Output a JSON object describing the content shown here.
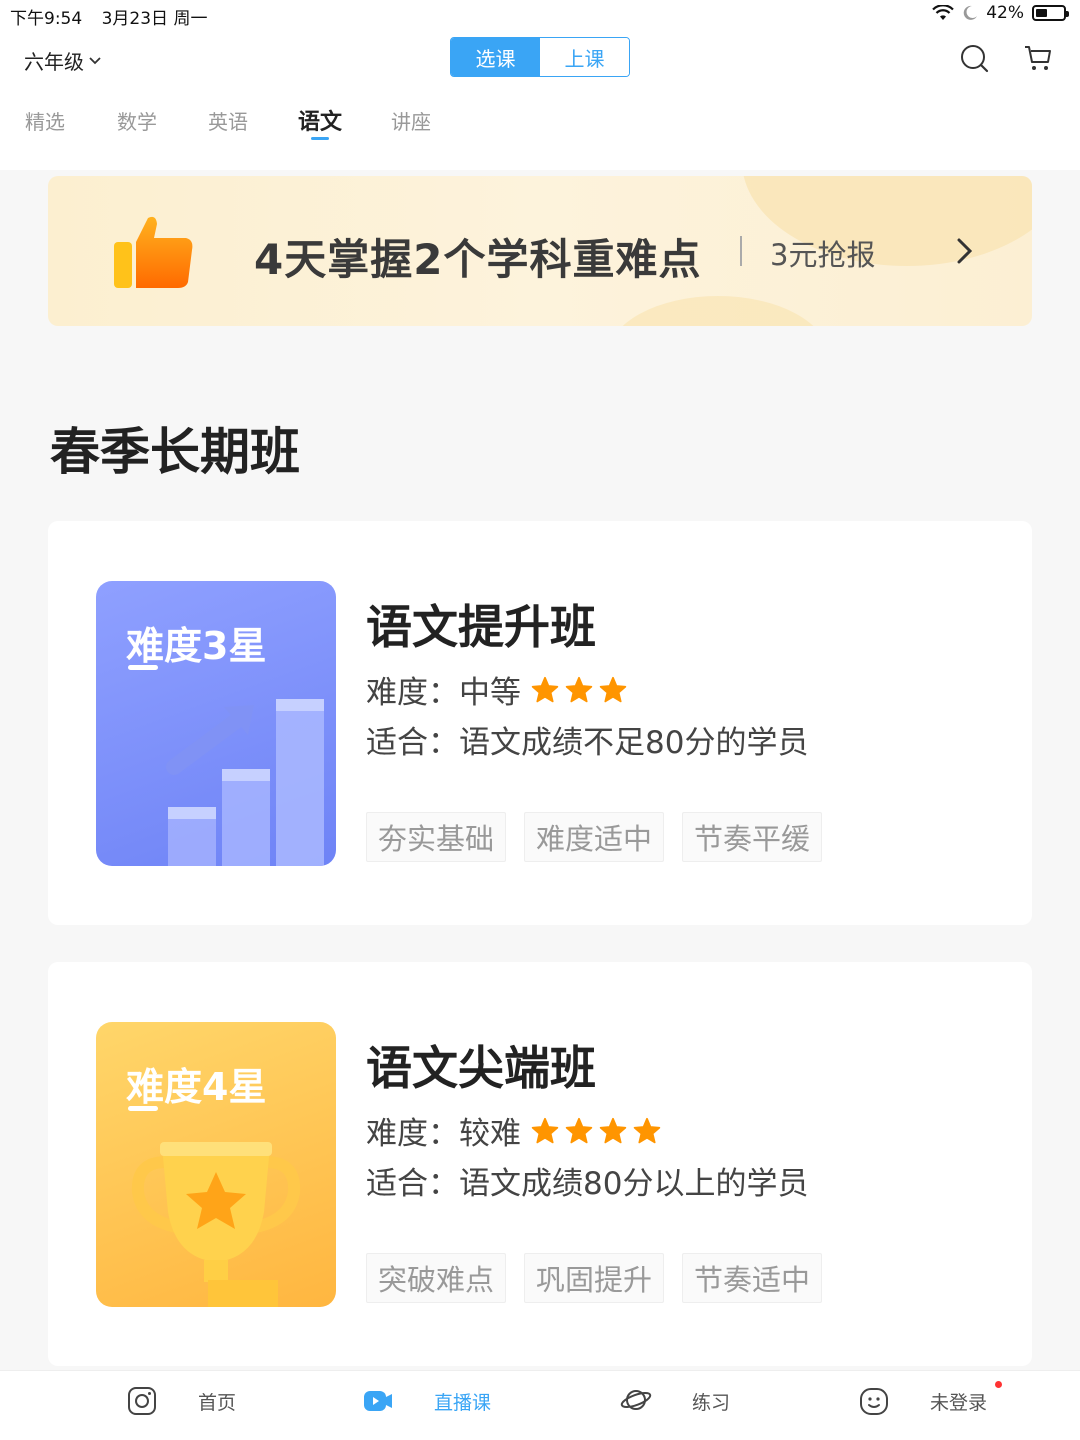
{
  "status_bar": {
    "time": "下午9:54",
    "date": "3月23日 周一",
    "battery_percent": "42%",
    "battery_level": 0.42
  },
  "header": {
    "grade": "六年级",
    "segments": [
      "选课",
      "上课"
    ],
    "active_segment": 0,
    "tabs": [
      "精选",
      "数学",
      "英语",
      "语文",
      "讲座"
    ],
    "active_tab": 3
  },
  "banner": {
    "title": "4天掌握2个学科重难点",
    "price": "3元抢报"
  },
  "section_title": "春季长期班",
  "courses": [
    {
      "thumb_label": "难度3星",
      "title": "语文提升班",
      "difficulty_label": "难度：",
      "difficulty_value": "中等",
      "stars": 3,
      "suit_label": "适合：",
      "suit_value": "语文成绩不足80分的学员",
      "tags": [
        "夯实基础",
        "难度适中",
        "节奏平缓"
      ]
    },
    {
      "thumb_label": "难度4星",
      "title": "语文尖端班",
      "difficulty_label": "难度：",
      "difficulty_value": "较难",
      "stars": 4,
      "suit_label": "适合：",
      "suit_value": "语文成绩80分以上的学员",
      "tags": [
        "突破难点",
        "巩固提升",
        "节奏适中"
      ]
    }
  ],
  "bottom_nav": [
    {
      "label": "首页",
      "icon": "camera-frame-icon"
    },
    {
      "label": "直播课",
      "icon": "live-video-icon"
    },
    {
      "label": "练习",
      "icon": "planet-icon"
    },
    {
      "label": "未登录",
      "icon": "smiley-face-icon"
    }
  ],
  "colors": {
    "accent": "#3aa5f5",
    "star": "#ff9500"
  }
}
